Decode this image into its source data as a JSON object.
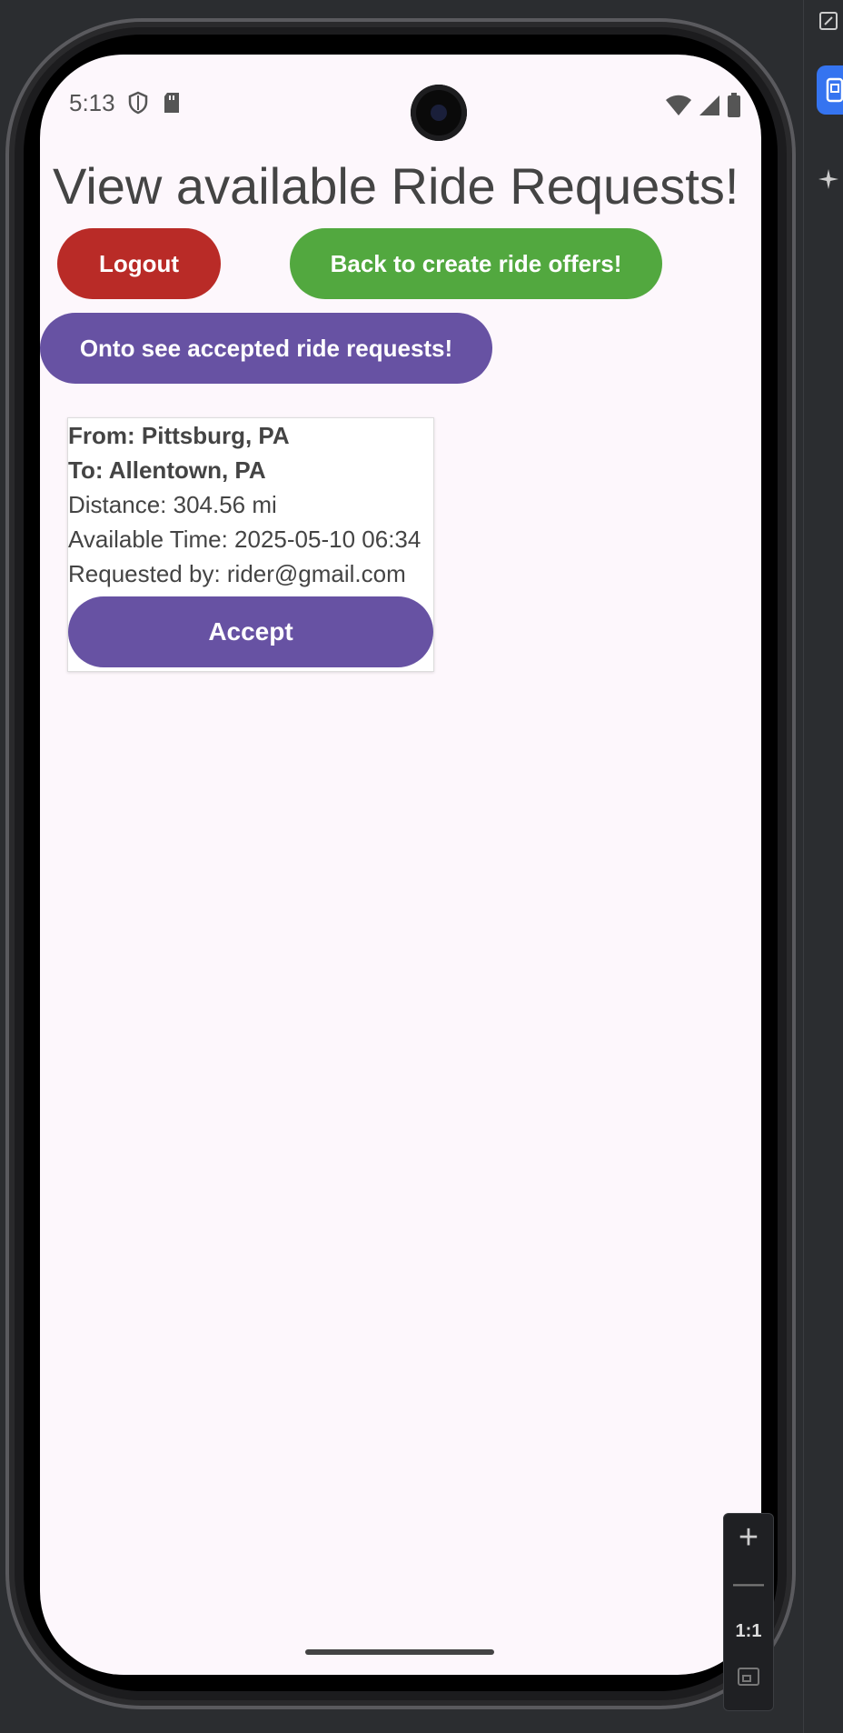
{
  "status_bar": {
    "time": "5:13",
    "left_icons": [
      "shield-icon",
      "sd-card-icon"
    ],
    "right_icons": [
      "wifi-icon",
      "cellular-icon",
      "battery-icon"
    ]
  },
  "page": {
    "title": "View available Ride Requests!"
  },
  "buttons": {
    "logout": "Logout",
    "back": "Back to create ride offers!",
    "onto": "Onto see accepted ride requests!"
  },
  "colors": {
    "logout": "#b92b27",
    "back": "#52a83f",
    "primary": "#6752a3",
    "screen_bg": "#fdf7fc"
  },
  "requests": [
    {
      "from": "From: Pittsburg, PA",
      "to": "To: Allentown, PA",
      "distance": "Distance: 304.56 mi",
      "time": "Available Time: 2025-05-10 06:34",
      "requested_by": "Requested by: rider@gmail.com",
      "accept_label": "Accept"
    }
  ],
  "emulator_zoom": {
    "plus": "+",
    "minus": "—",
    "ratio": "1:1"
  }
}
